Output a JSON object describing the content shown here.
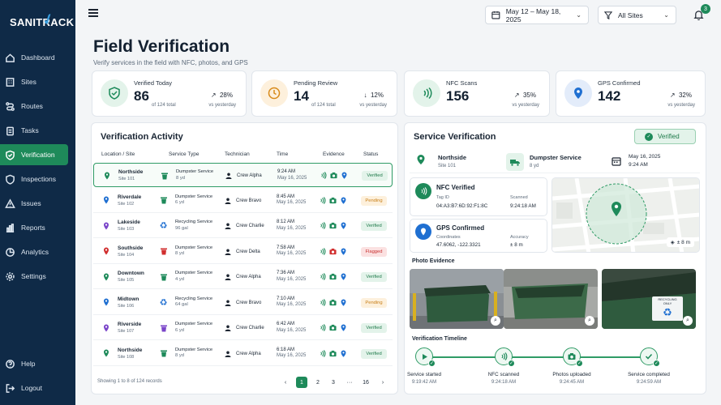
{
  "app": {
    "logo": "SANITRACK"
  },
  "sidebar": {
    "items": [
      {
        "label": "Dashboard",
        "icon": "home-icon"
      },
      {
        "label": "Sites",
        "icon": "building-icon"
      },
      {
        "label": "Routes",
        "icon": "route-icon"
      },
      {
        "label": "Tasks",
        "icon": "clipboard-icon"
      },
      {
        "label": "Verification",
        "icon": "shield-check-icon",
        "active": true
      },
      {
        "label": "Inspections",
        "icon": "shield-icon"
      },
      {
        "label": "Issues",
        "icon": "warning-icon"
      },
      {
        "label": "Reports",
        "icon": "bar-chart-icon"
      },
      {
        "label": "Analytics",
        "icon": "pie-chart-icon"
      },
      {
        "label": "Settings",
        "icon": "gear-icon"
      }
    ],
    "bottom": [
      {
        "label": "Help",
        "icon": "help-icon"
      },
      {
        "label": "Logout",
        "icon": "logout-icon"
      }
    ]
  },
  "header": {
    "date_range": "May 12 – May 18, 2025",
    "site_filter": "All Sites",
    "notifications": "3"
  },
  "page": {
    "title": "Field Verification",
    "subtitle": "Verify services in the field with NFC, photos, and GPS"
  },
  "stats": [
    {
      "label": "Verified Today",
      "value": "86",
      "sub": "of 124 total",
      "trend": "28%",
      "trend_dir": "↗",
      "vs": "vs yesterday",
      "color": "#1e8a5a",
      "bg": "#e3f3ea"
    },
    {
      "label": "Pending Review",
      "value": "14",
      "sub": "of 124 total",
      "trend": "12%",
      "trend_dir": "↓",
      "vs": "vs yesterday",
      "color": "#d88a1a",
      "bg": "#fdf0dc"
    },
    {
      "label": "NFC Scans",
      "value": "156",
      "sub": "",
      "trend": "35%",
      "trend_dir": "↗",
      "vs": "vs yesterday",
      "color": "#1e8a5a",
      "bg": "#e3f3ea"
    },
    {
      "label": "GPS Confirmed",
      "value": "142",
      "sub": "",
      "trend": "32%",
      "trend_dir": "↗",
      "vs": "vs yesterday",
      "color": "#1f6fd1",
      "bg": "#e3ecfa"
    }
  ],
  "activity": {
    "title": "Verification Activity",
    "columns": [
      "Location / Site",
      "Service Type",
      "Technician",
      "Time",
      "Evidence",
      "Status"
    ],
    "rows": [
      {
        "loc": "Northside",
        "site": "Site 101",
        "svc": "Dumpster Service",
        "size": "8 yd",
        "tech": "Crew Alpha",
        "time": "9:24 AM",
        "date": "May 16, 2025",
        "status": "Verified",
        "pin": "#1e8a5a",
        "svc_color": "#1e8a5a",
        "cam": "#1e8a5a"
      },
      {
        "loc": "Riverdale",
        "site": "Site 102",
        "svc": "Dumpster Service",
        "size": "6 yd",
        "tech": "Crew Bravo",
        "time": "8:45 AM",
        "date": "May 16, 2025",
        "status": "Pending",
        "pin": "#1f6fd1",
        "svc_color": "#1e8a5a",
        "cam": "#1e8a5a"
      },
      {
        "loc": "Lakeside",
        "site": "Site 103",
        "svc": "Recycling Service",
        "size": "96 gal",
        "tech": "Crew Charlie",
        "time": "8:12 AM",
        "date": "May 16, 2025",
        "status": "Verified",
        "pin": "#7a45c9",
        "svc_color": "#1f6fd1",
        "cam": "#1e8a5a"
      },
      {
        "loc": "Southside",
        "site": "Site 104",
        "svc": "Dumpster Service",
        "size": "8 yd",
        "tech": "Crew Delta",
        "time": "7:58 AM",
        "date": "May 16, 2025",
        "status": "Flagged",
        "pin": "#d12f2f",
        "svc_color": "#d12f2f",
        "cam": "#d12f2f"
      },
      {
        "loc": "Downtown",
        "site": "Site 105",
        "svc": "Dumpster Service",
        "size": "4 yd",
        "tech": "Crew Alpha",
        "time": "7:36 AM",
        "date": "May 16, 2025",
        "status": "Verified",
        "pin": "#1e8a5a",
        "svc_color": "#1e8a5a",
        "cam": "#1e8a5a"
      },
      {
        "loc": "Midtown",
        "site": "Site 106",
        "svc": "Recycling Service",
        "size": "64 gal",
        "tech": "Crew Bravo",
        "time": "7:10 AM",
        "date": "May 16, 2025",
        "status": "Pending",
        "pin": "#1f6fd1",
        "svc_color": "#1f6fd1",
        "cam": "#1e8a5a"
      },
      {
        "loc": "Riverside",
        "site": "Site 107",
        "svc": "Dumpster Service",
        "size": "6 yd",
        "tech": "Crew Charlie",
        "time": "6:42 AM",
        "date": "May 16, 2025",
        "status": "Verified",
        "pin": "#7a45c9",
        "svc_color": "#7a45c9",
        "cam": "#1e8a5a"
      },
      {
        "loc": "Northside",
        "site": "Site 108",
        "svc": "Dumpster Service",
        "size": "8 yd",
        "tech": "Crew Alpha",
        "time": "6:18 AM",
        "date": "May 16, 2025",
        "status": "Verified",
        "pin": "#1e8a5a",
        "svc_color": "#1e8a5a",
        "cam": "#1e8a5a"
      }
    ],
    "footer": "Showing 1 to 8 of 124 records",
    "pages": [
      "‹",
      "1",
      "2",
      "3",
      "···",
      "16",
      "›"
    ]
  },
  "service": {
    "title": "Service Verification",
    "status": "Verified",
    "location": "Northside",
    "site": "Site 101",
    "type": "Dumpster Service",
    "size": "8 yd",
    "date": "May 16, 2025",
    "time": "9:24 AM",
    "nfc": {
      "title": "NFC Verified",
      "tag_label": "Tag ID",
      "tag": "04:A3:B7:6D:92:F1:8C",
      "scanned_label": "Scanned",
      "scanned": "9:24:18 AM"
    },
    "gps": {
      "title": "GPS Confirmed",
      "coord_label": "Coordinates",
      "coords": "47.6062, -122.3321",
      "acc_label": "Accuracy",
      "accuracy": "± 8 m"
    },
    "map_accuracy": "± 8 m",
    "photos_title": "Photo Evidence",
    "recycling_sign": "RECYCLING ONLY",
    "timeline_title": "Verification Timeline",
    "timeline": [
      {
        "label": "Service started",
        "time": "9:19:42 AM"
      },
      {
        "label": "NFC scanned",
        "time": "9:24:18 AM"
      },
      {
        "label": "Photos uploaded",
        "time": "9:24:45 AM"
      },
      {
        "label": "Service completed",
        "time": "9:24:59 AM"
      }
    ]
  }
}
